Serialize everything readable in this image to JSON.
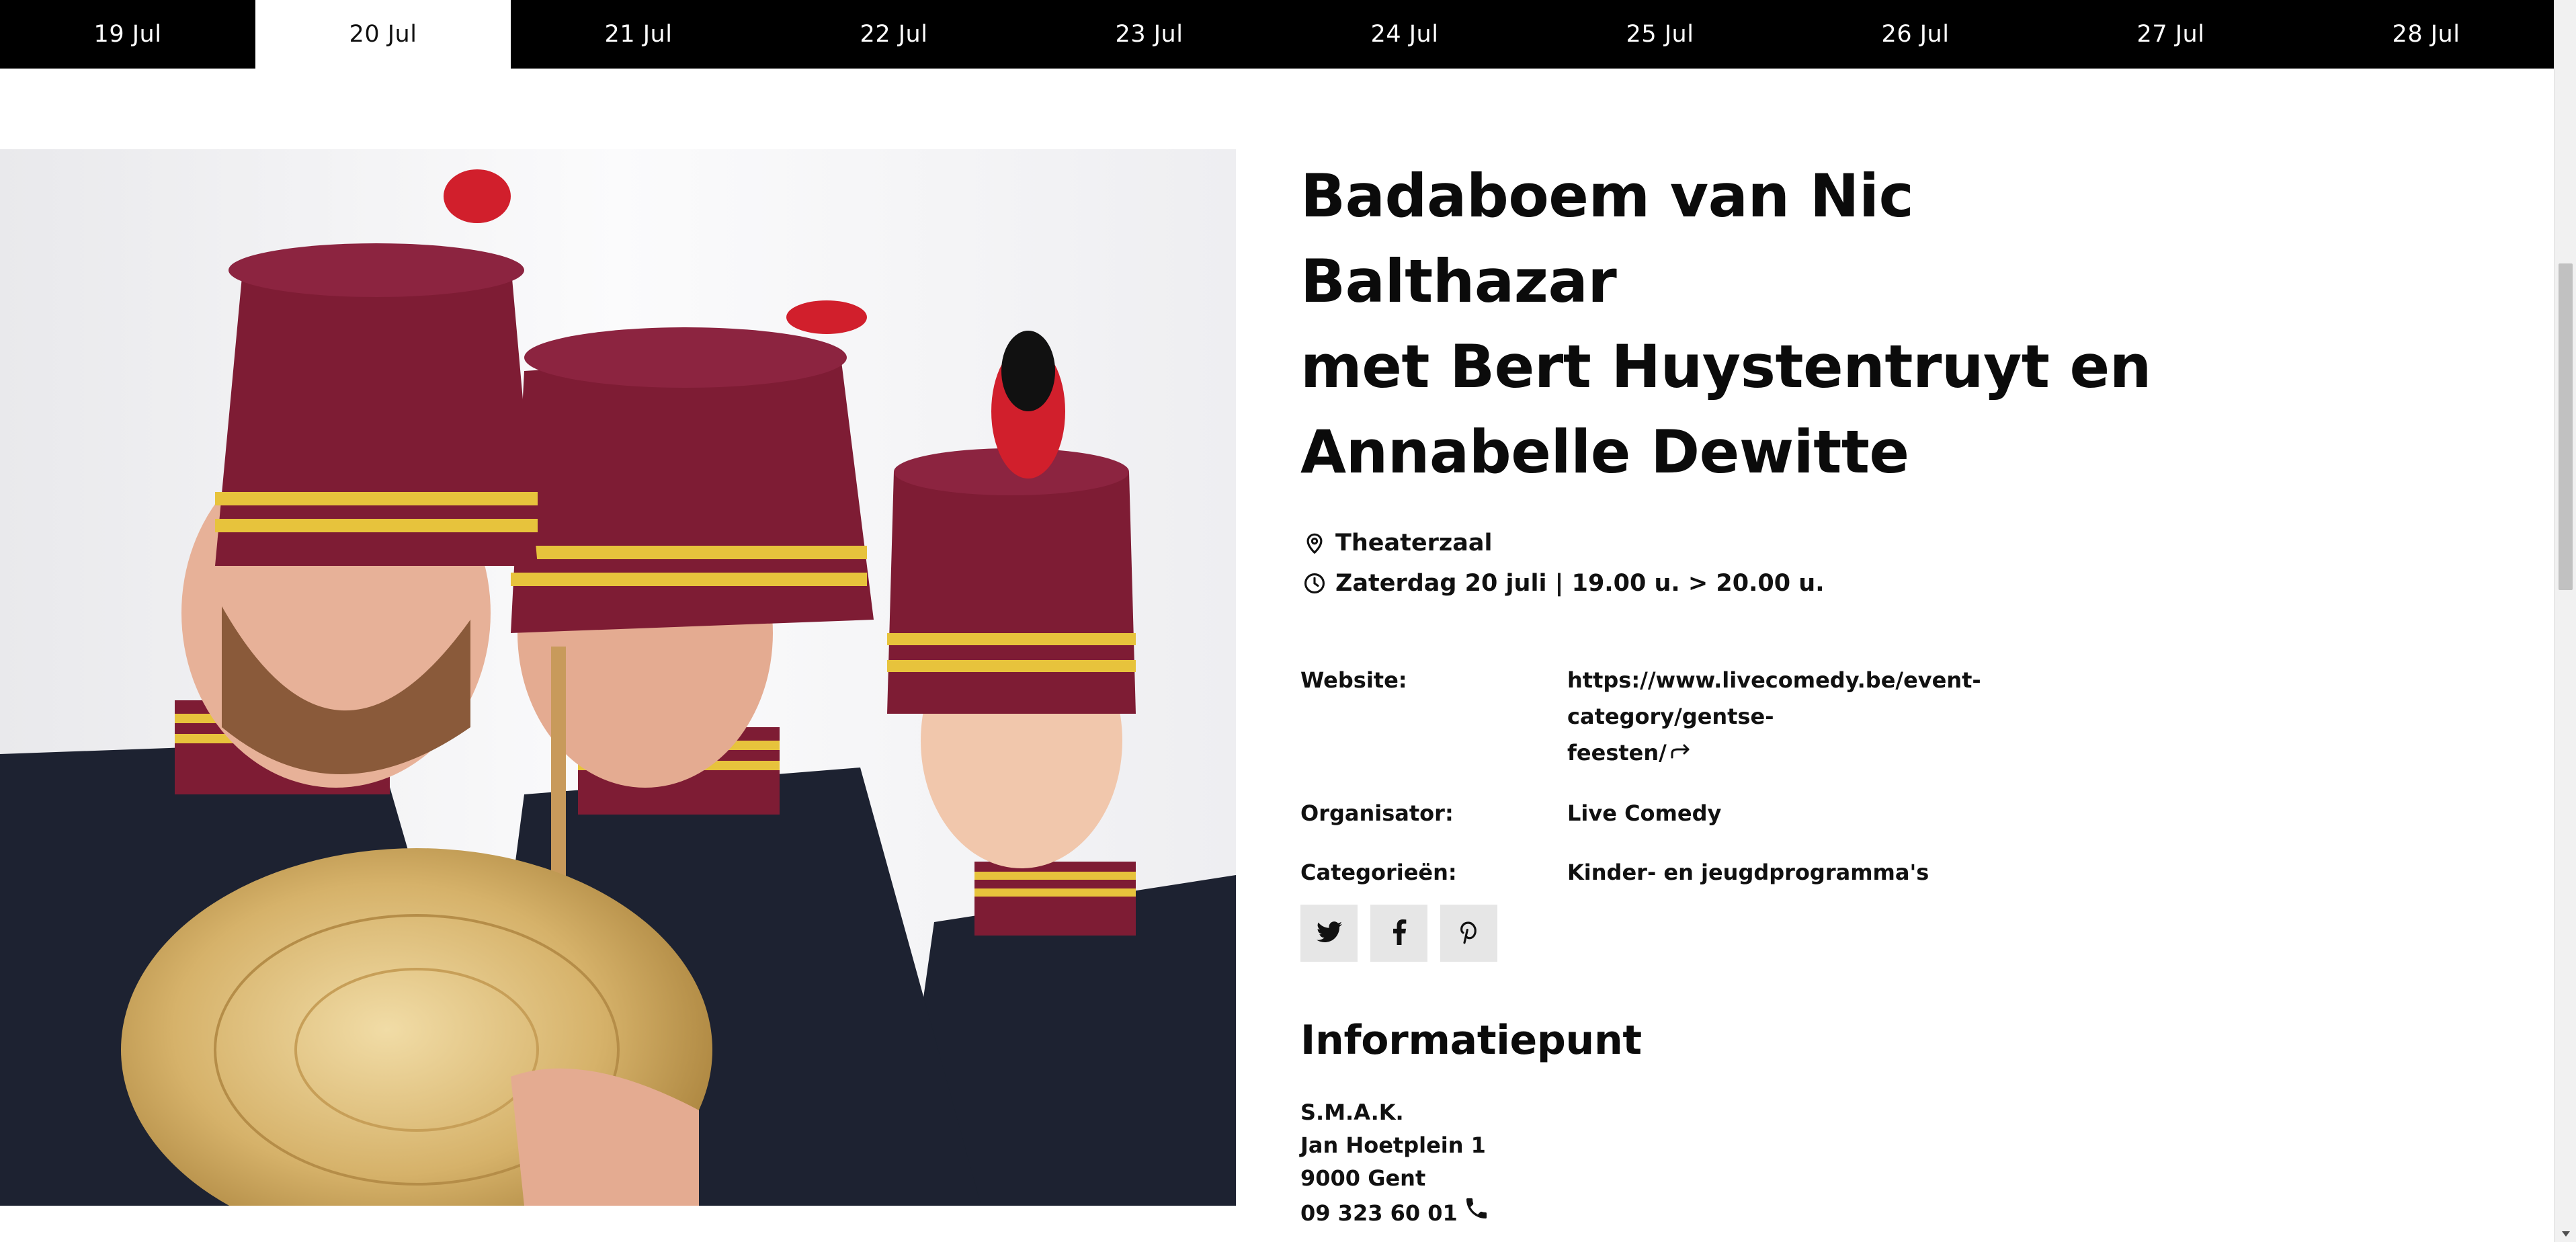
{
  "dates": {
    "active_index": 1,
    "tabs": [
      "19 Jul",
      "20 Jul",
      "21 Jul",
      "22 Jul",
      "23 Jul",
      "24 Jul",
      "25 Jul",
      "26 Jul",
      "27 Jul",
      "28 Jul"
    ]
  },
  "event": {
    "title_lines": [
      "Badaboem van Nic Balthazar",
      "met Bert Huystentruyt en",
      "Annabelle Dewitte"
    ],
    "location": "Theaterzaal",
    "datetime": "Zaterdag 20 juli | 19.00 u. > 20.00 u.",
    "details": {
      "website_label": "Website:",
      "website_line1": "https://www.livecomedy.be/event-category/gentse-",
      "website_line2": "feesten/",
      "organizer_label": "Organisator:",
      "organizer_value": "Live Comedy",
      "categories_label": "Categorieën:",
      "categories_value": "Kinder- en jeugdprogramma's"
    },
    "share": [
      "twitter-icon",
      "facebook-icon",
      "pinterest-icon"
    ]
  },
  "infopoint": {
    "heading": "Informatiepunt",
    "name": "S.M.A.K.",
    "street": "Jan Hoetplein 1",
    "city": "9000 Gent",
    "phone": "09 323 60 01"
  },
  "colors": {
    "bar_bg": "#000000",
    "active_tab_bg": "#ffffff",
    "share_button_bg": "#e6e6e6",
    "uniform_hat": "#7e1c34",
    "uniform_jacket": "#1d2231",
    "braid_gold": "#e7c33c"
  }
}
